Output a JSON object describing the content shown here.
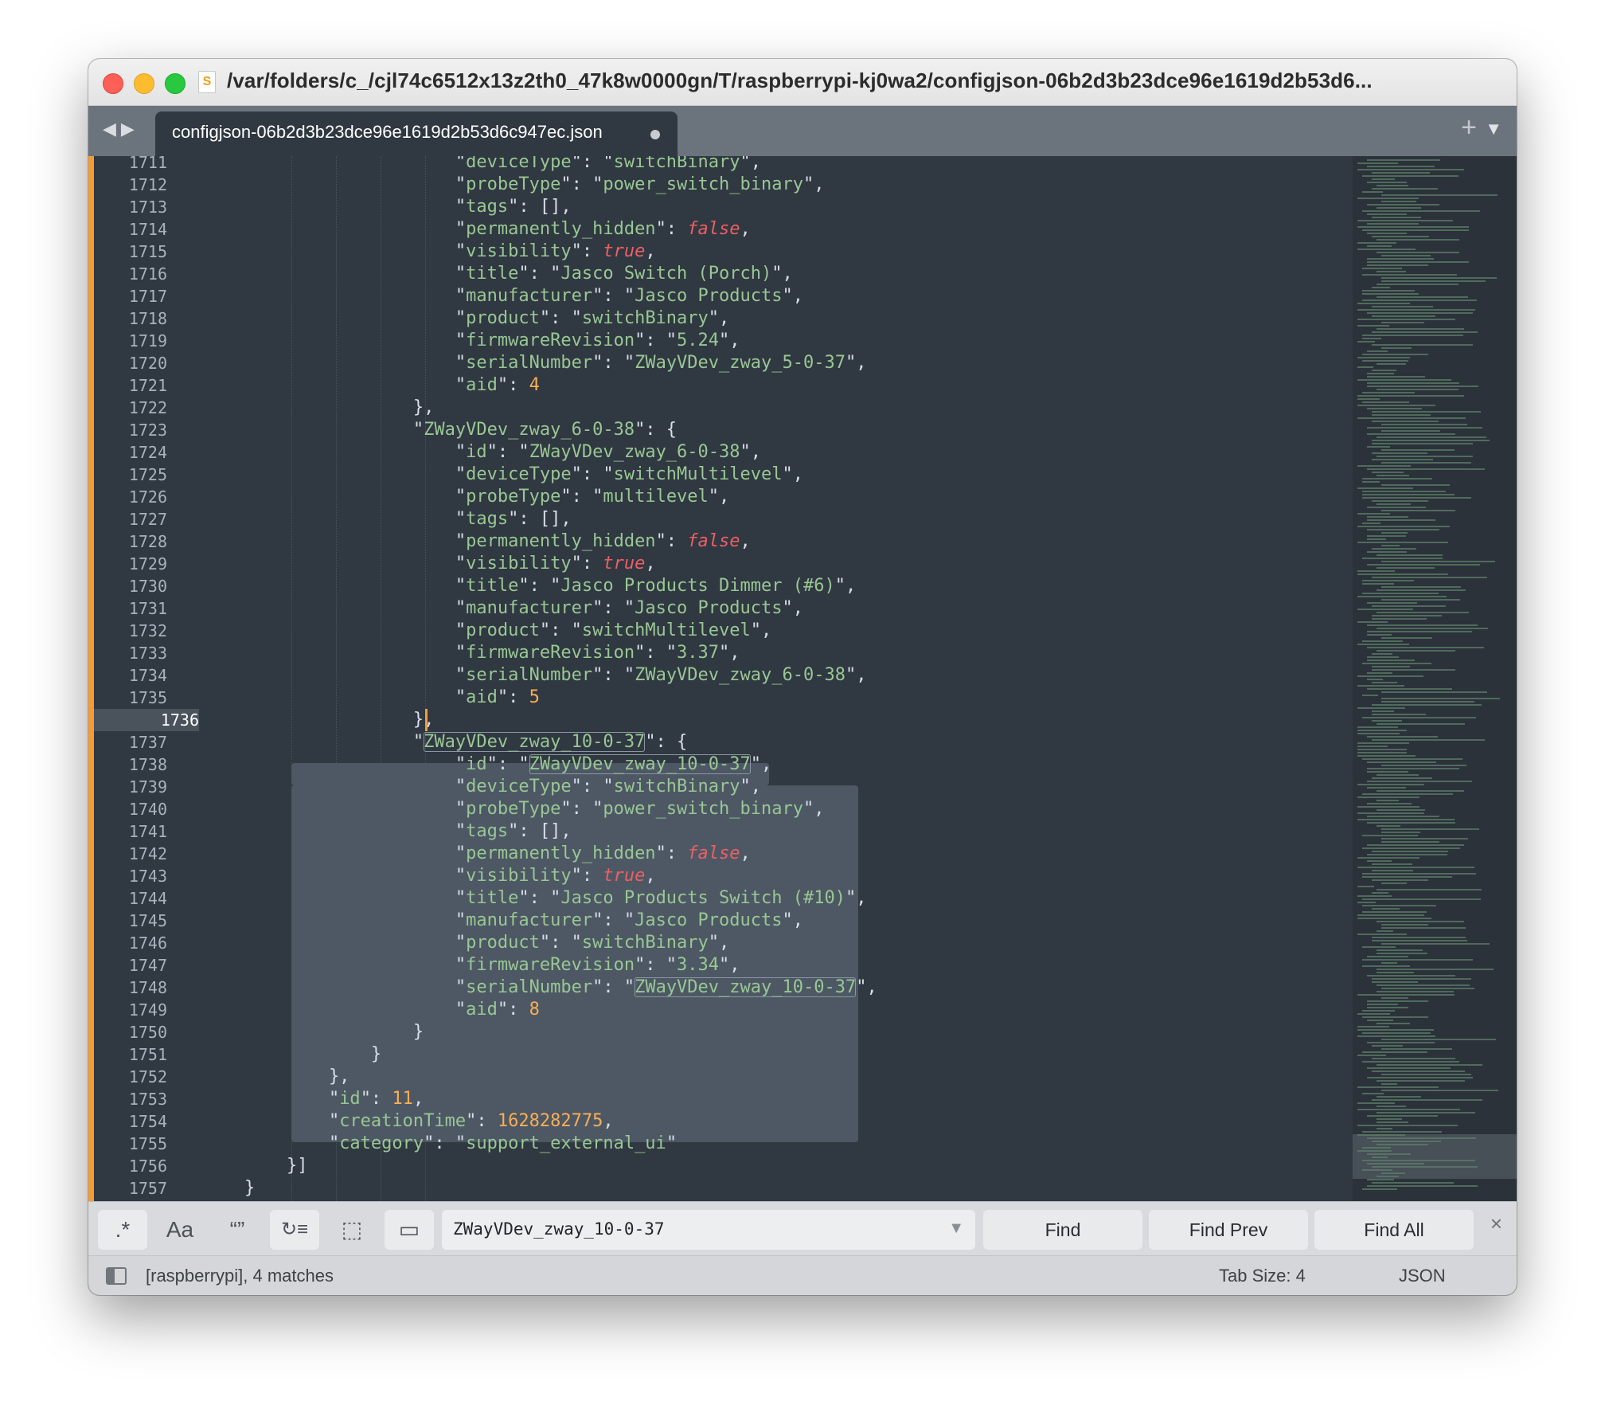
{
  "window": {
    "title": "/var/folders/c_/cjl74c6512x13z2th0_47k8w0000gn/T/raspberrypi-kj0wa2/configjson-06b2d3b23dce96e1619d2b53d6..."
  },
  "tabs": [
    {
      "label": "configjson-06b2d3b23dce96e1619d2b53d6c947ec.json",
      "dirty": true
    }
  ],
  "editor": {
    "active_line": 1736,
    "line_numbers": [
      "1711",
      "1712",
      "1713",
      "1714",
      "1715",
      "1716",
      "1717",
      "1718",
      "1719",
      "1720",
      "1721",
      "1722",
      "1723",
      "1724",
      "1725",
      "1726",
      "1727",
      "1728",
      "1729",
      "1730",
      "1731",
      "1732",
      "1733",
      "1734",
      "1735",
      "1736",
      "1737",
      "1738",
      "1739",
      "1740",
      "1741",
      "1742",
      "1743",
      "1744",
      "1745",
      "1746",
      "1747",
      "1748",
      "1749",
      "1750",
      "1751",
      "1752",
      "1753",
      "1754",
      "1755",
      "1756",
      "1757"
    ],
    "lines": [
      [
        [
          "p",
          "                        \""
        ],
        [
          "s",
          "deviceType"
        ],
        [
          "p",
          "\": \""
        ],
        [
          "s",
          "switchBinary"
        ],
        [
          "p",
          "\","
        ]
      ],
      [
        [
          "p",
          "                        \""
        ],
        [
          "s",
          "probeType"
        ],
        [
          "p",
          "\": \""
        ],
        [
          "s",
          "power_switch_binary"
        ],
        [
          "p",
          "\","
        ]
      ],
      [
        [
          "p",
          "                        \""
        ],
        [
          "s",
          "tags"
        ],
        [
          "p",
          "\": [],"
        ]
      ],
      [
        [
          "p",
          "                        \""
        ],
        [
          "s",
          "permanently_hidden"
        ],
        [
          "p",
          "\": "
        ],
        [
          "b",
          "false"
        ],
        [
          "p",
          ","
        ]
      ],
      [
        [
          "p",
          "                        \""
        ],
        [
          "s",
          "visibility"
        ],
        [
          "p",
          "\": "
        ],
        [
          "b",
          "true"
        ],
        [
          "p",
          ","
        ]
      ],
      [
        [
          "p",
          "                        \""
        ],
        [
          "s",
          "title"
        ],
        [
          "p",
          "\": \""
        ],
        [
          "s",
          "Jasco Switch (Porch)"
        ],
        [
          "p",
          "\","
        ]
      ],
      [
        [
          "p",
          "                        \""
        ],
        [
          "s",
          "manufacturer"
        ],
        [
          "p",
          "\": \""
        ],
        [
          "s",
          "Jasco Products"
        ],
        [
          "p",
          "\","
        ]
      ],
      [
        [
          "p",
          "                        \""
        ],
        [
          "s",
          "product"
        ],
        [
          "p",
          "\": \""
        ],
        [
          "s",
          "switchBinary"
        ],
        [
          "p",
          "\","
        ]
      ],
      [
        [
          "p",
          "                        \""
        ],
        [
          "s",
          "firmwareRevision"
        ],
        [
          "p",
          "\": \""
        ],
        [
          "s",
          "5.24"
        ],
        [
          "p",
          "\","
        ]
      ],
      [
        [
          "p",
          "                        \""
        ],
        [
          "s",
          "serialNumber"
        ],
        [
          "p",
          "\": \""
        ],
        [
          "s",
          "ZWayVDev_zway_5-0-37"
        ],
        [
          "p",
          "\","
        ]
      ],
      [
        [
          "p",
          "                        \""
        ],
        [
          "s",
          "aid"
        ],
        [
          "p",
          "\": "
        ],
        [
          "n",
          "4"
        ]
      ],
      [
        [
          "p",
          "                    },"
        ]
      ],
      [
        [
          "p",
          "                    \""
        ],
        [
          "s",
          "ZWayVDev_zway_6-0-38"
        ],
        [
          "p",
          "\": {"
        ]
      ],
      [
        [
          "p",
          "                        \""
        ],
        [
          "s",
          "id"
        ],
        [
          "p",
          "\": \""
        ],
        [
          "s",
          "ZWayVDev_zway_6-0-38"
        ],
        [
          "p",
          "\","
        ]
      ],
      [
        [
          "p",
          "                        \""
        ],
        [
          "s",
          "deviceType"
        ],
        [
          "p",
          "\": \""
        ],
        [
          "s",
          "switchMultilevel"
        ],
        [
          "p",
          "\","
        ]
      ],
      [
        [
          "p",
          "                        \""
        ],
        [
          "s",
          "probeType"
        ],
        [
          "p",
          "\": \""
        ],
        [
          "s",
          "multilevel"
        ],
        [
          "p",
          "\","
        ]
      ],
      [
        [
          "p",
          "                        \""
        ],
        [
          "s",
          "tags"
        ],
        [
          "p",
          "\": [],"
        ]
      ],
      [
        [
          "p",
          "                        \""
        ],
        [
          "s",
          "permanently_hidden"
        ],
        [
          "p",
          "\": "
        ],
        [
          "b",
          "false"
        ],
        [
          "p",
          ","
        ]
      ],
      [
        [
          "p",
          "                        \""
        ],
        [
          "s",
          "visibility"
        ],
        [
          "p",
          "\": "
        ],
        [
          "b",
          "true"
        ],
        [
          "p",
          ","
        ]
      ],
      [
        [
          "p",
          "                        \""
        ],
        [
          "s",
          "title"
        ],
        [
          "p",
          "\": \""
        ],
        [
          "s",
          "Jasco Products Dimmer (#6)"
        ],
        [
          "p",
          "\","
        ]
      ],
      [
        [
          "p",
          "                        \""
        ],
        [
          "s",
          "manufacturer"
        ],
        [
          "p",
          "\": \""
        ],
        [
          "s",
          "Jasco Products"
        ],
        [
          "p",
          "\","
        ]
      ],
      [
        [
          "p",
          "                        \""
        ],
        [
          "s",
          "product"
        ],
        [
          "p",
          "\": \""
        ],
        [
          "s",
          "switchMultilevel"
        ],
        [
          "p",
          "\","
        ]
      ],
      [
        [
          "p",
          "                        \""
        ],
        [
          "s",
          "firmwareRevision"
        ],
        [
          "p",
          "\": \""
        ],
        [
          "s",
          "3.37"
        ],
        [
          "p",
          "\","
        ]
      ],
      [
        [
          "p",
          "                        \""
        ],
        [
          "s",
          "serialNumber"
        ],
        [
          "p",
          "\": \""
        ],
        [
          "s",
          "ZWayVDev_zway_6-0-38"
        ],
        [
          "p",
          "\","
        ]
      ],
      [
        [
          "p",
          "                        \""
        ],
        [
          "s",
          "aid"
        ],
        [
          "p",
          "\": "
        ],
        [
          "n",
          "5"
        ]
      ],
      [
        [
          "p",
          "                    },"
        ]
      ],
      [
        [
          "p",
          "                    \""
        ],
        [
          "s",
          "ZWayVDev_zway_10-0-37"
        ],
        [
          "p",
          "\": {"
        ]
      ],
      [
        [
          "p",
          "                        \""
        ],
        [
          "s",
          "id"
        ],
        [
          "p",
          "\": \""
        ],
        [
          "s",
          "ZWayVDev_zway_10-0-37"
        ],
        [
          "p",
          "\","
        ]
      ],
      [
        [
          "p",
          "                        \""
        ],
        [
          "s",
          "deviceType"
        ],
        [
          "p",
          "\": \""
        ],
        [
          "s",
          "switchBinary"
        ],
        [
          "p",
          "\","
        ]
      ],
      [
        [
          "p",
          "                        \""
        ],
        [
          "s",
          "probeType"
        ],
        [
          "p",
          "\": \""
        ],
        [
          "s",
          "power_switch_binary"
        ],
        [
          "p",
          "\","
        ]
      ],
      [
        [
          "p",
          "                        \""
        ],
        [
          "s",
          "tags"
        ],
        [
          "p",
          "\": [],"
        ]
      ],
      [
        [
          "p",
          "                        \""
        ],
        [
          "s",
          "permanently_hidden"
        ],
        [
          "p",
          "\": "
        ],
        [
          "b",
          "false"
        ],
        [
          "p",
          ","
        ]
      ],
      [
        [
          "p",
          "                        \""
        ],
        [
          "s",
          "visibility"
        ],
        [
          "p",
          "\": "
        ],
        [
          "b",
          "true"
        ],
        [
          "p",
          ","
        ]
      ],
      [
        [
          "p",
          "                        \""
        ],
        [
          "s",
          "title"
        ],
        [
          "p",
          "\": \""
        ],
        [
          "s",
          "Jasco Products Switch (#10)"
        ],
        [
          "p",
          "\","
        ]
      ],
      [
        [
          "p",
          "                        \""
        ],
        [
          "s",
          "manufacturer"
        ],
        [
          "p",
          "\": \""
        ],
        [
          "s",
          "Jasco Products"
        ],
        [
          "p",
          "\","
        ]
      ],
      [
        [
          "p",
          "                        \""
        ],
        [
          "s",
          "product"
        ],
        [
          "p",
          "\": \""
        ],
        [
          "s",
          "switchBinary"
        ],
        [
          "p",
          "\","
        ]
      ],
      [
        [
          "p",
          "                        \""
        ],
        [
          "s",
          "firmwareRevision"
        ],
        [
          "p",
          "\": \""
        ],
        [
          "s",
          "3.34"
        ],
        [
          "p",
          "\","
        ]
      ],
      [
        [
          "p",
          "                        \""
        ],
        [
          "s",
          "serialNumber"
        ],
        [
          "p",
          "\": \""
        ],
        [
          "s",
          "ZWayVDev_zway_10-0-37"
        ],
        [
          "p",
          "\","
        ]
      ],
      [
        [
          "p",
          "                        \""
        ],
        [
          "s",
          "aid"
        ],
        [
          "p",
          "\": "
        ],
        [
          "n",
          "8"
        ]
      ],
      [
        [
          "p",
          "                    }"
        ]
      ],
      [
        [
          "p",
          "                }"
        ]
      ],
      [
        [
          "p",
          "            },"
        ]
      ],
      [
        [
          "p",
          "            \""
        ],
        [
          "s",
          "id"
        ],
        [
          "p",
          "\": "
        ],
        [
          "n",
          "11"
        ],
        [
          "p",
          ","
        ]
      ],
      [
        [
          "p",
          "            \""
        ],
        [
          "s",
          "creationTime"
        ],
        [
          "p",
          "\": "
        ],
        [
          "n",
          "1628282775"
        ],
        [
          "p",
          ","
        ]
      ],
      [
        [
          "p",
          "            \""
        ],
        [
          "s",
          "category"
        ],
        [
          "p",
          "\": \""
        ],
        [
          "s",
          "support_external_ui"
        ],
        [
          "p",
          "\""
        ]
      ],
      [
        [
          "p",
          "        }]"
        ]
      ],
      [
        [
          "p",
          "    }"
        ]
      ]
    ]
  },
  "find_panel": {
    "options": [
      {
        "name": "regex-toggle",
        "glyph": ".*",
        "on": true
      },
      {
        "name": "case-sensitive-toggle",
        "glyph": "Aa",
        "on": false
      },
      {
        "name": "whole-word-toggle",
        "glyph": "“”",
        "on": false
      },
      {
        "name": "wrap-toggle",
        "glyph": "↻≡",
        "on": true
      },
      {
        "name": "in-selection-toggle",
        "glyph": "⬚",
        "on": false
      },
      {
        "name": "highlight-matches-toggle",
        "glyph": "▭",
        "on": true
      }
    ],
    "query": "ZWayVDev_zway_10-0-37",
    "find_label": "Find",
    "find_prev_label": "Find Prev",
    "find_all_label": "Find All",
    "close_glyph": "×"
  },
  "status_bar": {
    "left_text": "[raspberrypi], 4 matches",
    "tab_size": "Tab Size: 4",
    "syntax": "JSON"
  }
}
